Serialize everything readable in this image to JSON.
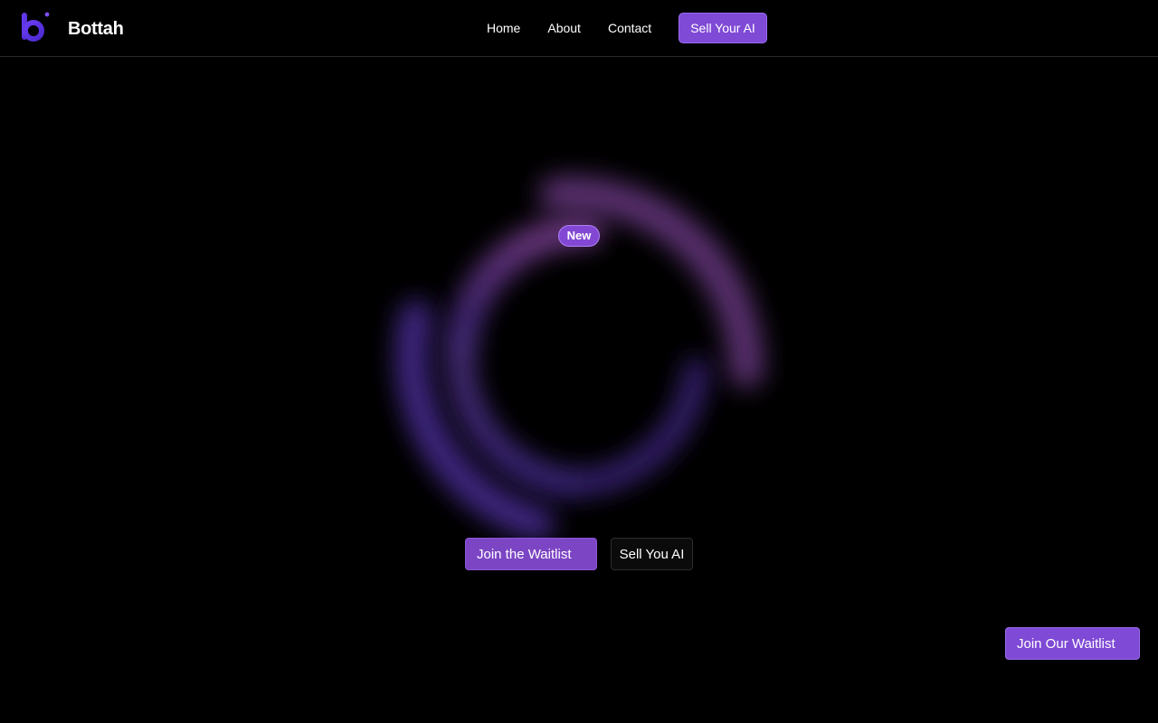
{
  "header": {
    "brand": "Bottah",
    "logo_icon": "bottah-b-logo-icon",
    "nav": [
      {
        "label": "Home"
      },
      {
        "label": "About"
      },
      {
        "label": "Contact"
      }
    ],
    "cta_label": "Sell Your AI"
  },
  "hero": {
    "badge": "New",
    "primary_button": "Join the Waitlist",
    "secondary_button": "Sell You AI"
  },
  "floating_cta": "Join Our Waitlist",
  "colors": {
    "background": "#000000",
    "accent": "#7f4ad6",
    "glow_top": "#6a3a85",
    "glow_bottom": "#4c2f94"
  }
}
